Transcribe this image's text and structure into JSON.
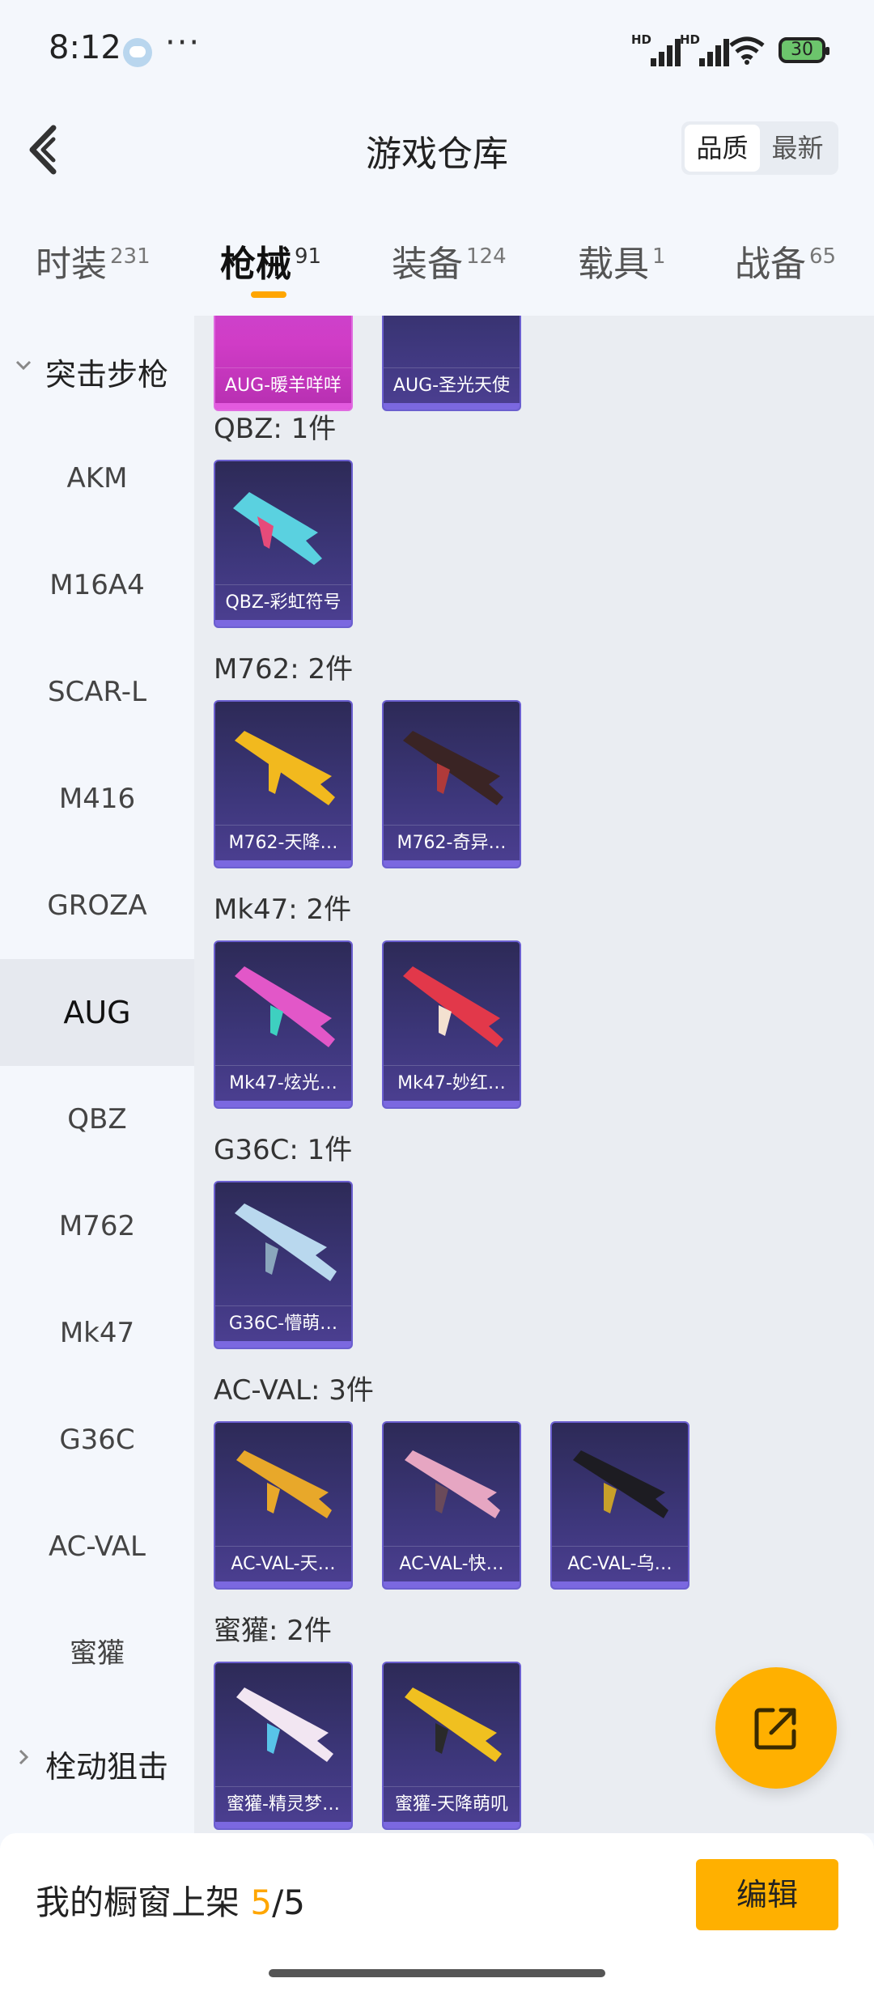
{
  "status_bar": {
    "time": "8:12",
    "dots": "···",
    "net1": "HD",
    "net2": "HD",
    "battery": "30"
  },
  "header": {
    "title": "游戏仓库",
    "sort_options": [
      "品质",
      "最新"
    ],
    "sort_selected": "品质"
  },
  "tabs": [
    {
      "label": "时装",
      "count": "231"
    },
    {
      "label": "枪械",
      "count": "91"
    },
    {
      "label": "装备",
      "count": "124"
    },
    {
      "label": "载具",
      "count": "1"
    },
    {
      "label": "战备",
      "count": "65"
    }
  ],
  "active_tab": "枪械",
  "sidebar": {
    "group_expanded": "突击步枪",
    "items": [
      "AKM",
      "M16A4",
      "SCAR-L",
      "M416",
      "GROZA",
      "AUG",
      "QBZ",
      "M762",
      "Mk47",
      "G36C",
      "AC-VAL",
      "蜜獾"
    ],
    "active_item": "AUG",
    "group_collapsed": "栓动狙击"
  },
  "sections": {
    "aug": {
      "items": [
        "AUG-暖羊咩咩",
        "AUG-圣光天使"
      ]
    },
    "qbz": {
      "label": "QBZ: 1件",
      "items": [
        "QBZ-彩虹符号"
      ]
    },
    "m762": {
      "label": "M762: 2件",
      "items": [
        "M762-天降…",
        "M762-奇异…"
      ]
    },
    "mk47": {
      "label": "Mk47: 2件",
      "items": [
        "Mk47-炫光…",
        "Mk47-妙红…"
      ]
    },
    "g36c": {
      "label": "G36C: 1件",
      "items": [
        "G36C-懵萌…"
      ]
    },
    "acval": {
      "label": "AC-VAL: 3件",
      "items": [
        "AC-VAL-天…",
        "AC-VAL-快…",
        "AC-VAL-乌…"
      ]
    },
    "honey": {
      "label": "蜜獾: 2件",
      "items": [
        "蜜獾-精灵梦…",
        "蜜獾-天降萌叽"
      ]
    }
  },
  "bottom_bar": {
    "prefix": "我的橱窗上架 ",
    "current": "5",
    "suffix": "/5",
    "edit_label": "编辑"
  },
  "colors": {
    "accent": "#ffb000",
    "card_bg": "#3c3679",
    "card_pink": "#d03cc6"
  },
  "icons": [
    "back-arrow-icon",
    "share-export-icon",
    "chevron-down-icon",
    "chevron-right-icon",
    "wifi-icon",
    "battery-icon"
  ]
}
